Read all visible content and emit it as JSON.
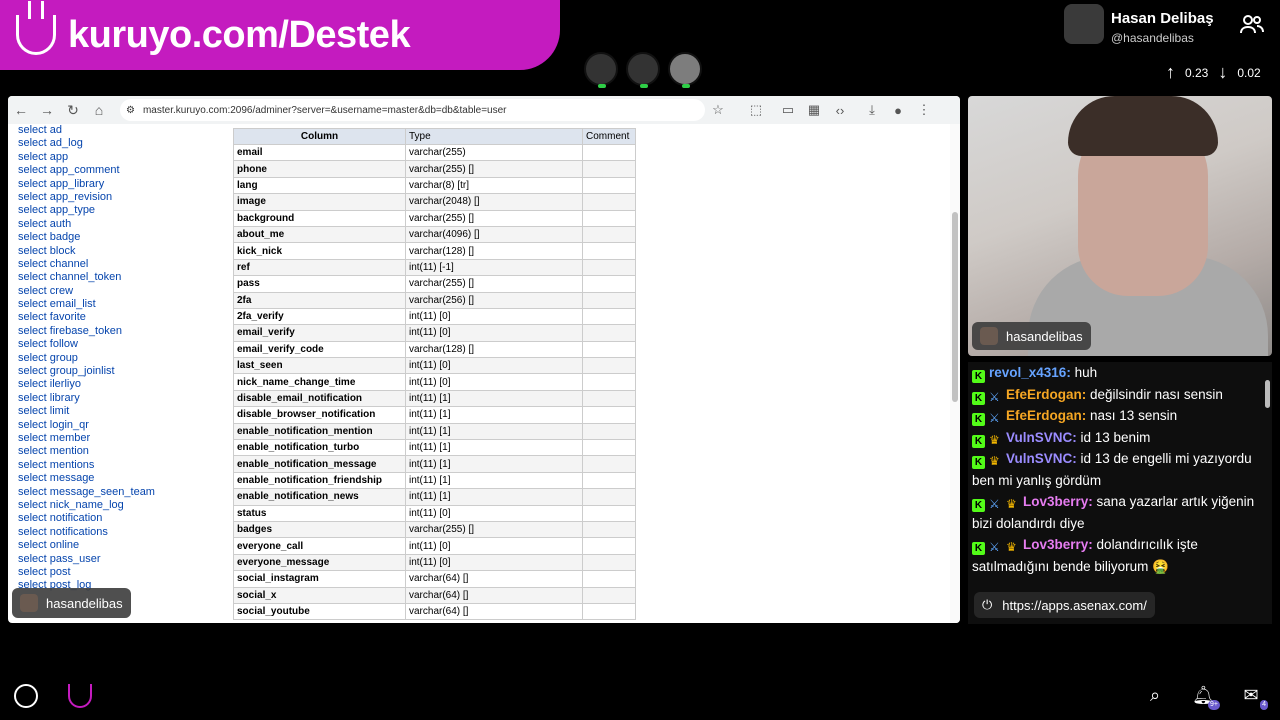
{
  "banner": {
    "url": "kuruyo.com/Destek"
  },
  "streamer": {
    "name": "Hasan Delibaş",
    "handle": "@hasandelibas"
  },
  "net": {
    "up": "0.23",
    "down": "0.02"
  },
  "browser": {
    "address": "master.kuruyo.com:2096/adminer?server=&username=master&db=db&table=user",
    "sidebar": [
      "select ad",
      "select ad_log",
      "select app",
      "select app_comment",
      "select app_library",
      "select app_revision",
      "select app_type",
      "select auth",
      "select badge",
      "select block",
      "select channel",
      "select channel_token",
      "select crew",
      "select email_list",
      "select favorite",
      "select firebase_token",
      "select follow",
      "select group",
      "select group_joinlist",
      "select ilerliyo",
      "select library",
      "select limit",
      "select login_qr",
      "select member",
      "select mention",
      "select mentions",
      "select message",
      "select message_seen_team",
      "select nick_name_log",
      "select notification",
      "select notifications",
      "select online",
      "select pass_user",
      "select post",
      "select post_log"
    ],
    "table_headers": {
      "column": "Column",
      "type": "Type",
      "comment": "Comment"
    },
    "rows": [
      {
        "col": "email",
        "type": "varchar(255)"
      },
      {
        "col": "phone",
        "type": "varchar(255) []"
      },
      {
        "col": "lang",
        "type": "varchar(8) [tr]"
      },
      {
        "col": "image",
        "type": "varchar(2048) []"
      },
      {
        "col": "background",
        "type": "varchar(255) []"
      },
      {
        "col": "about_me",
        "type": "varchar(4096) []"
      },
      {
        "col": "kick_nick",
        "type": "varchar(128) []"
      },
      {
        "col": "ref",
        "type": "int(11) [-1]"
      },
      {
        "col": "pass",
        "type": "varchar(255) []"
      },
      {
        "col": "2fa",
        "type": "varchar(256) []"
      },
      {
        "col": "2fa_verify",
        "type": "int(11) [0]"
      },
      {
        "col": "email_verify",
        "type": "int(11) [0]"
      },
      {
        "col": "email_verify_code",
        "type": "varchar(128) []"
      },
      {
        "col": "last_seen",
        "type": "int(11) [0]"
      },
      {
        "col": "nick_name_change_time",
        "type": "int(11) [0]"
      },
      {
        "col": "disable_email_notification",
        "type": "int(11) [1]"
      },
      {
        "col": "disable_browser_notification",
        "type": "int(11) [1]"
      },
      {
        "col": "enable_notification_mention",
        "type": "int(11) [1]"
      },
      {
        "col": "enable_notification_turbo",
        "type": "int(11) [1]"
      },
      {
        "col": "enable_notification_message",
        "type": "int(11) [1]"
      },
      {
        "col": "enable_notification_friendship",
        "type": "int(11) [1]"
      },
      {
        "col": "enable_notification_news",
        "type": "int(11) [1]"
      },
      {
        "col": "status",
        "type": "int(11) [0]"
      },
      {
        "col": "badges",
        "type": "varchar(255) []"
      },
      {
        "col": "everyone_call",
        "type": "int(11) [0]"
      },
      {
        "col": "everyone_message",
        "type": "int(11) [0]"
      },
      {
        "col": "social_instagram",
        "type": "varchar(64) []"
      },
      {
        "col": "social_x",
        "type": "varchar(64) []"
      },
      {
        "col": "social_youtube",
        "type": "varchar(64) []"
      }
    ]
  },
  "screen_tag": "hasandelibas",
  "cam_tag": "hasandelibas",
  "chat": [
    {
      "badges": [
        "k"
      ],
      "user": "revol_x4316:",
      "color": "#66a3ff",
      "text": "huh"
    },
    {
      "badges": [
        "k",
        "sword"
      ],
      "user": "EfeErdogan:",
      "color": "#f5a623",
      "text": "değilsindir nası sensin"
    },
    {
      "badges": [
        "k",
        "sword"
      ],
      "user": "EfeErdogan:",
      "color": "#f5a623",
      "text": "nası 13 sensin"
    },
    {
      "badges": [
        "k",
        "crown"
      ],
      "user": "VulnSVNC:",
      "color": "#9b8cff",
      "text": "id 13 benim"
    },
    {
      "badges": [
        "k",
        "crown"
      ],
      "user": "VulnSVNC:",
      "color": "#9b8cff",
      "text": "id 13 de engelli mi yazıyordu ben mi yanlış gördüm"
    },
    {
      "badges": [
        "k",
        "sword",
        "crown"
      ],
      "user": "Lov3berry:",
      "color": "#e67cf0",
      "text": "sana yazarlar artık yiğenin bizi dolandırdı diye"
    },
    {
      "badges": [
        "k",
        "sword",
        "crown"
      ],
      "user": "Lov3berry:",
      "color": "#e67cf0",
      "text": "dolandırıcılık işte satılmadığını bende biliyorum 🤮"
    }
  ],
  "pinned_link": "https://apps.asenax.com/",
  "notification_count": "9+",
  "mail_count": "4"
}
